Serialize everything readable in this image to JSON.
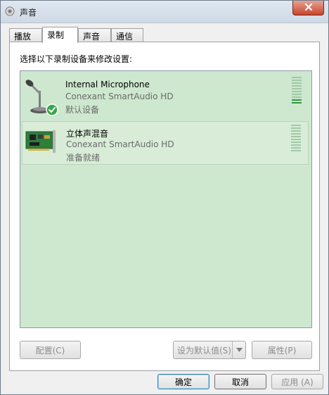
{
  "window": {
    "title": "声音"
  },
  "tabs": [
    {
      "label": "播放",
      "active": false
    },
    {
      "label": "录制",
      "active": true
    },
    {
      "label": "声音",
      "active": false
    },
    {
      "label": "通信",
      "active": false
    }
  ],
  "panel": {
    "instruction": "选择以下录制设备来修改设置:",
    "devices": [
      {
        "name": "Internal Microphone",
        "driver": "Conexant SmartAudio HD",
        "status": "默认设备",
        "icon": "microphone-icon",
        "default_badge": "green-check-icon",
        "level_segments_on": 2
      },
      {
        "name": "立体声混音",
        "driver": "Conexant SmartAudio HD",
        "status": "准备就绪",
        "icon": "sound-card-icon",
        "level_segments_on": 0
      }
    ],
    "buttons": {
      "configure": "配置(C)",
      "set_default": "设为默认值(S)",
      "properties": "属性(P)"
    }
  },
  "footer": {
    "ok": "确定",
    "cancel": "取消",
    "apply": "应用 (A)"
  },
  "colors": {
    "list_background": "#cde8cf",
    "meter_on": "#2f9a3d",
    "close_button": "#c7452d"
  }
}
